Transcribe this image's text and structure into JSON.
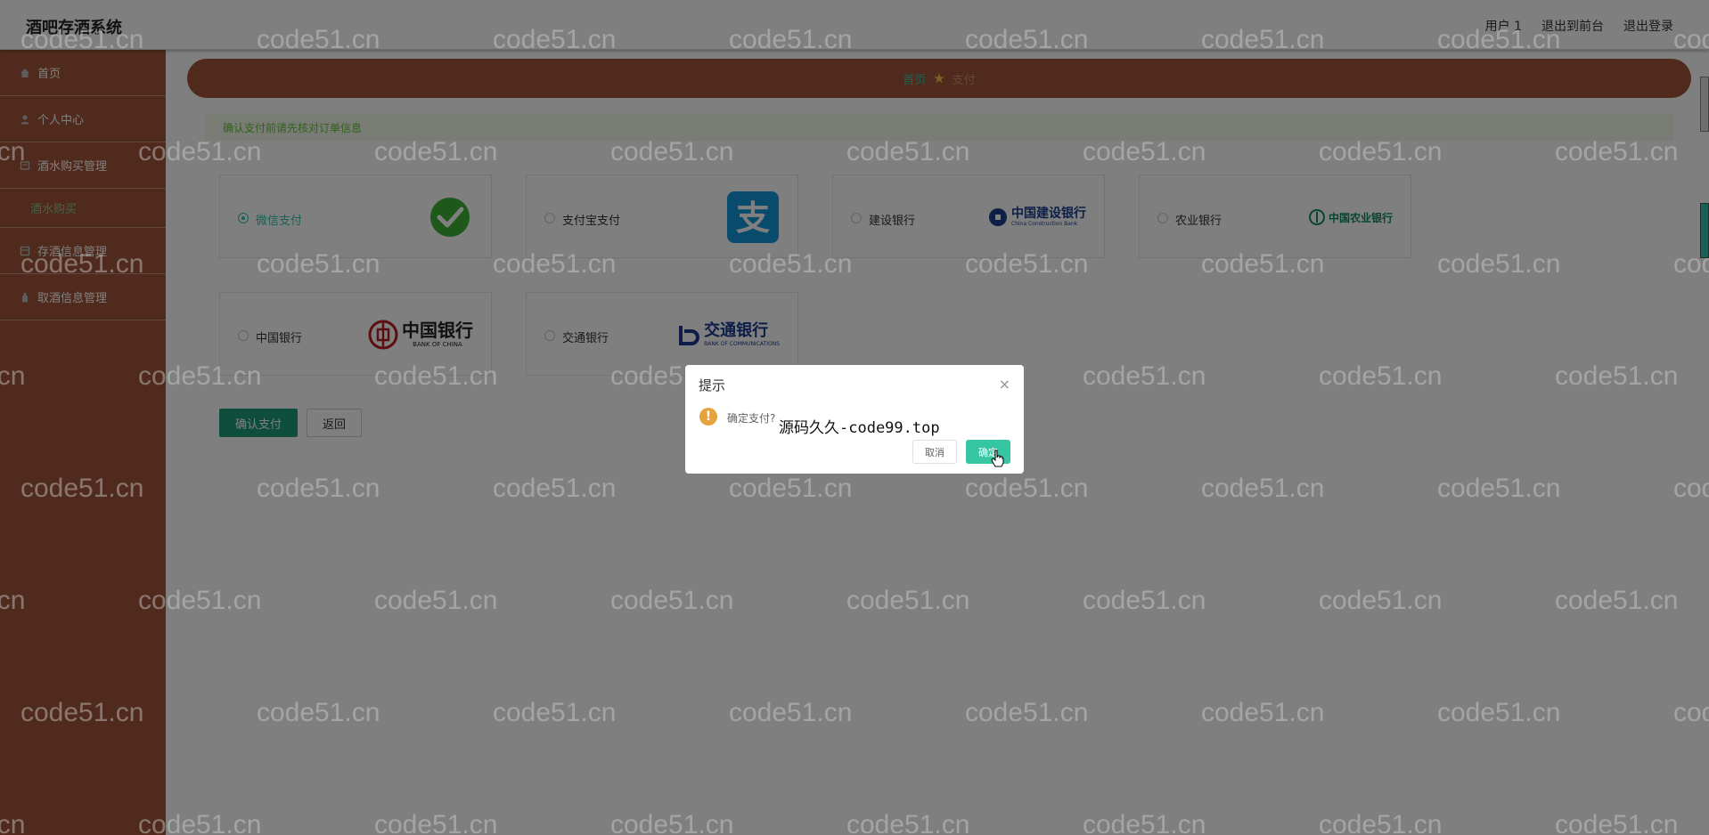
{
  "header": {
    "title": "酒吧存酒系统",
    "links": [
      "用户 1",
      "退出到前台",
      "退出登录"
    ]
  },
  "sidebar": {
    "items": [
      {
        "label": "首页",
        "icon": "home-icon"
      },
      {
        "label": "个人中心",
        "icon": "user-icon"
      },
      {
        "label": "酒水购买管理",
        "icon": "cart-icon"
      },
      {
        "label": "存酒信息管理",
        "icon": "archive-icon"
      },
      {
        "label": "取酒信息管理",
        "icon": "bottle-icon"
      }
    ],
    "sub_item": "酒水购买"
  },
  "breadcrumb": {
    "home": "首页",
    "current": "支付"
  },
  "notice": "确认支付前请先核对订单信息",
  "payment_options": [
    {
      "label": "微信支付",
      "selected": true,
      "logo": "wechat-pay-logo"
    },
    {
      "label": "支付宝支付",
      "selected": false,
      "logo": "alipay-logo"
    },
    {
      "label": "建设银行",
      "selected": false,
      "logo": "ccb-logo",
      "logo_text": "中国建设银行",
      "logo_sub": "China Construction Bank"
    },
    {
      "label": "农业银行",
      "selected": false,
      "logo": "abc-logo",
      "logo_text": "中国农业银行"
    },
    {
      "label": "中国银行",
      "selected": false,
      "logo": "boc-logo",
      "logo_text": "中国银行",
      "logo_sub": "BANK OF CHINA"
    },
    {
      "label": "交通银行",
      "selected": false,
      "logo": "bocom-logo",
      "logo_text": "交通银行",
      "logo_sub": "BANK OF COMMUNICATIONS"
    }
  ],
  "buttons": {
    "confirm": "确认支付",
    "back": "返回"
  },
  "dialog": {
    "title": "提示",
    "close": "×",
    "message": "确定支付?",
    "overlay_text": "源码久久-code99.top",
    "cancel": "取消",
    "ok": "确定"
  },
  "watermark": {
    "text": "code51.cn"
  },
  "colors": {
    "sidebar": "#a0573a",
    "accent": "#2ec4a8",
    "confirm": "#1f9d78",
    "warning": "#e6a23c"
  }
}
